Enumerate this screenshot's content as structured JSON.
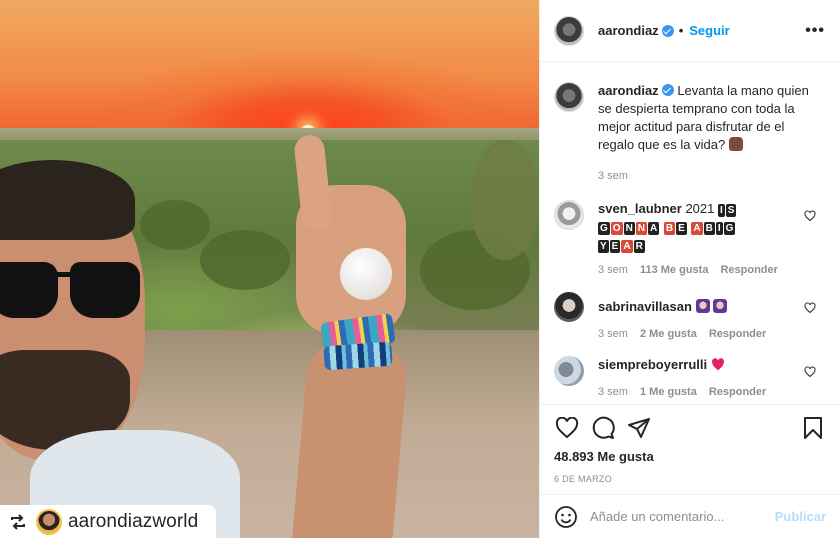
{
  "post": {
    "author": "aarondiaz",
    "follow_label": "Seguir",
    "dot": "•",
    "more_label": "•••",
    "repost_username": "aarondiazworld"
  },
  "caption": {
    "username": "aarondiaz",
    "text": "Levanta la mano quien se despierta temprano con toda la mejor actitud para disfrutar de el regalo que es la vida?",
    "time": "3 sem"
  },
  "comments": [
    {
      "username": "sven_laubner",
      "text_prefix": "2021",
      "badges": [
        "I",
        "S",
        "G",
        "O",
        "N",
        "N",
        "A",
        "B",
        "E",
        "A",
        "B",
        "I",
        "G",
        "Y",
        "E",
        "A",
        "R"
      ],
      "time": "3 sem",
      "likes": "113 Me gusta",
      "reply": "Responder"
    },
    {
      "username": "sabrinavillasan",
      "text_prefix": "",
      "time": "3 sem",
      "likes": "2 Me gusta",
      "reply": "Responder"
    },
    {
      "username": "siempreboyerrulli",
      "text_prefix": "",
      "time": "3 sem",
      "likes": "1 Me gusta",
      "reply": "Responder"
    }
  ],
  "stats": {
    "likes": "48.893 Me gusta",
    "date": "6 DE MARZO"
  },
  "composer": {
    "placeholder": "Añade un comentario...",
    "publish_label": "Publicar"
  },
  "colors": {
    "accent": "#0095f6",
    "verified": "#3897f0",
    "heart_red": "#ed4956"
  }
}
